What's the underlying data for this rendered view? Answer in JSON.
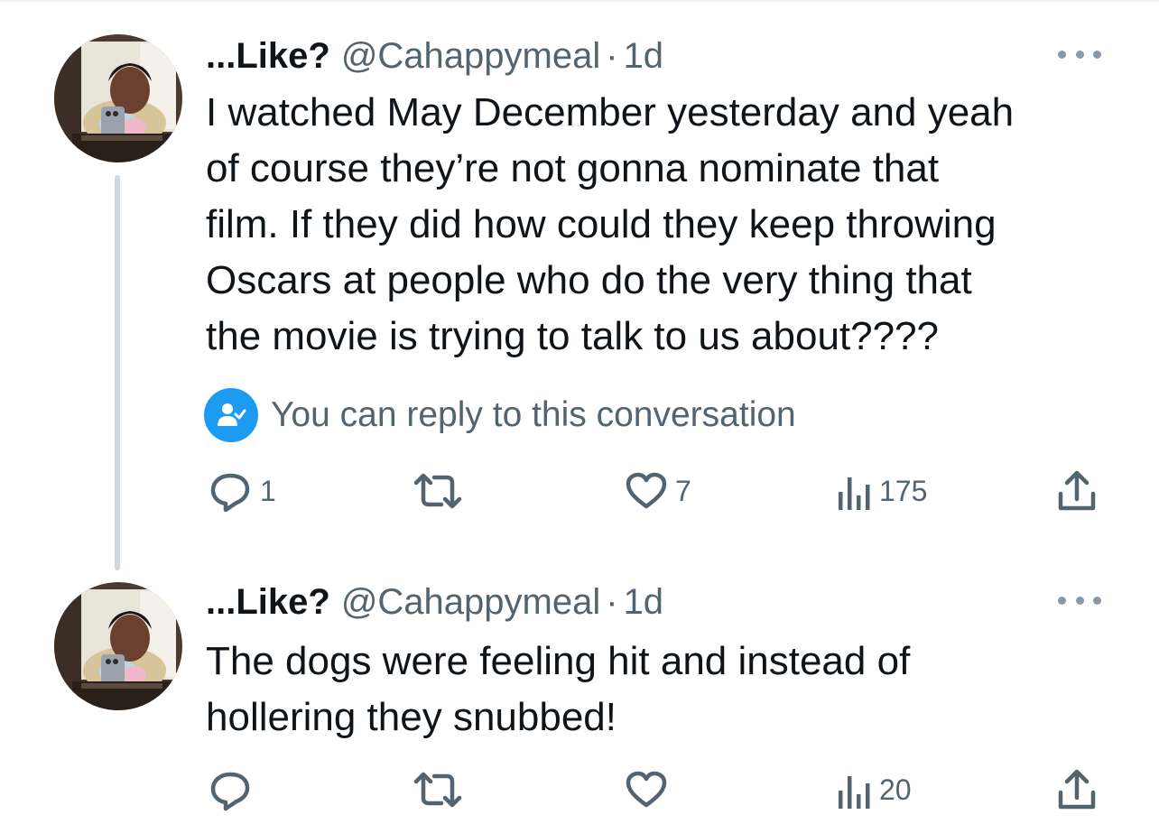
{
  "tweets": [
    {
      "display_name": "...Like?",
      "handle": "@Cahappymeal",
      "separator": "·",
      "time": "1d",
      "text_lines": [
        "I watched May December yesterday and yeah",
        "of course they’re not gonna nominate that",
        "film. If they did how could they keep throwing",
        "Oscars at people who do the very thing that",
        "the movie is trying to talk to us about????"
      ],
      "reply_notice": "You can reply to this conversation",
      "replies": "1",
      "retweets": "",
      "likes": "7",
      "views": "175"
    },
    {
      "display_name": "...Like?",
      "handle": "@Cahappymeal",
      "separator": "·",
      "time": "1d",
      "text_lines": [
        "The dogs were feeling hit and instead of",
        "hollering they snubbed!"
      ],
      "replies": "",
      "retweets": "",
      "likes": "",
      "views": "20"
    }
  ],
  "icons": {
    "more": "more-horizontal-icon",
    "reply_notice": "person-check-icon",
    "reply": "reply-icon",
    "retweet": "retweet-icon",
    "like": "heart-icon",
    "views": "analytics-icon",
    "share": "share-icon"
  },
  "colors": {
    "accent": "#1d9bf0",
    "text_primary": "#0f1419",
    "text_secondary": "#536471",
    "thread_line": "#cfd9de"
  }
}
